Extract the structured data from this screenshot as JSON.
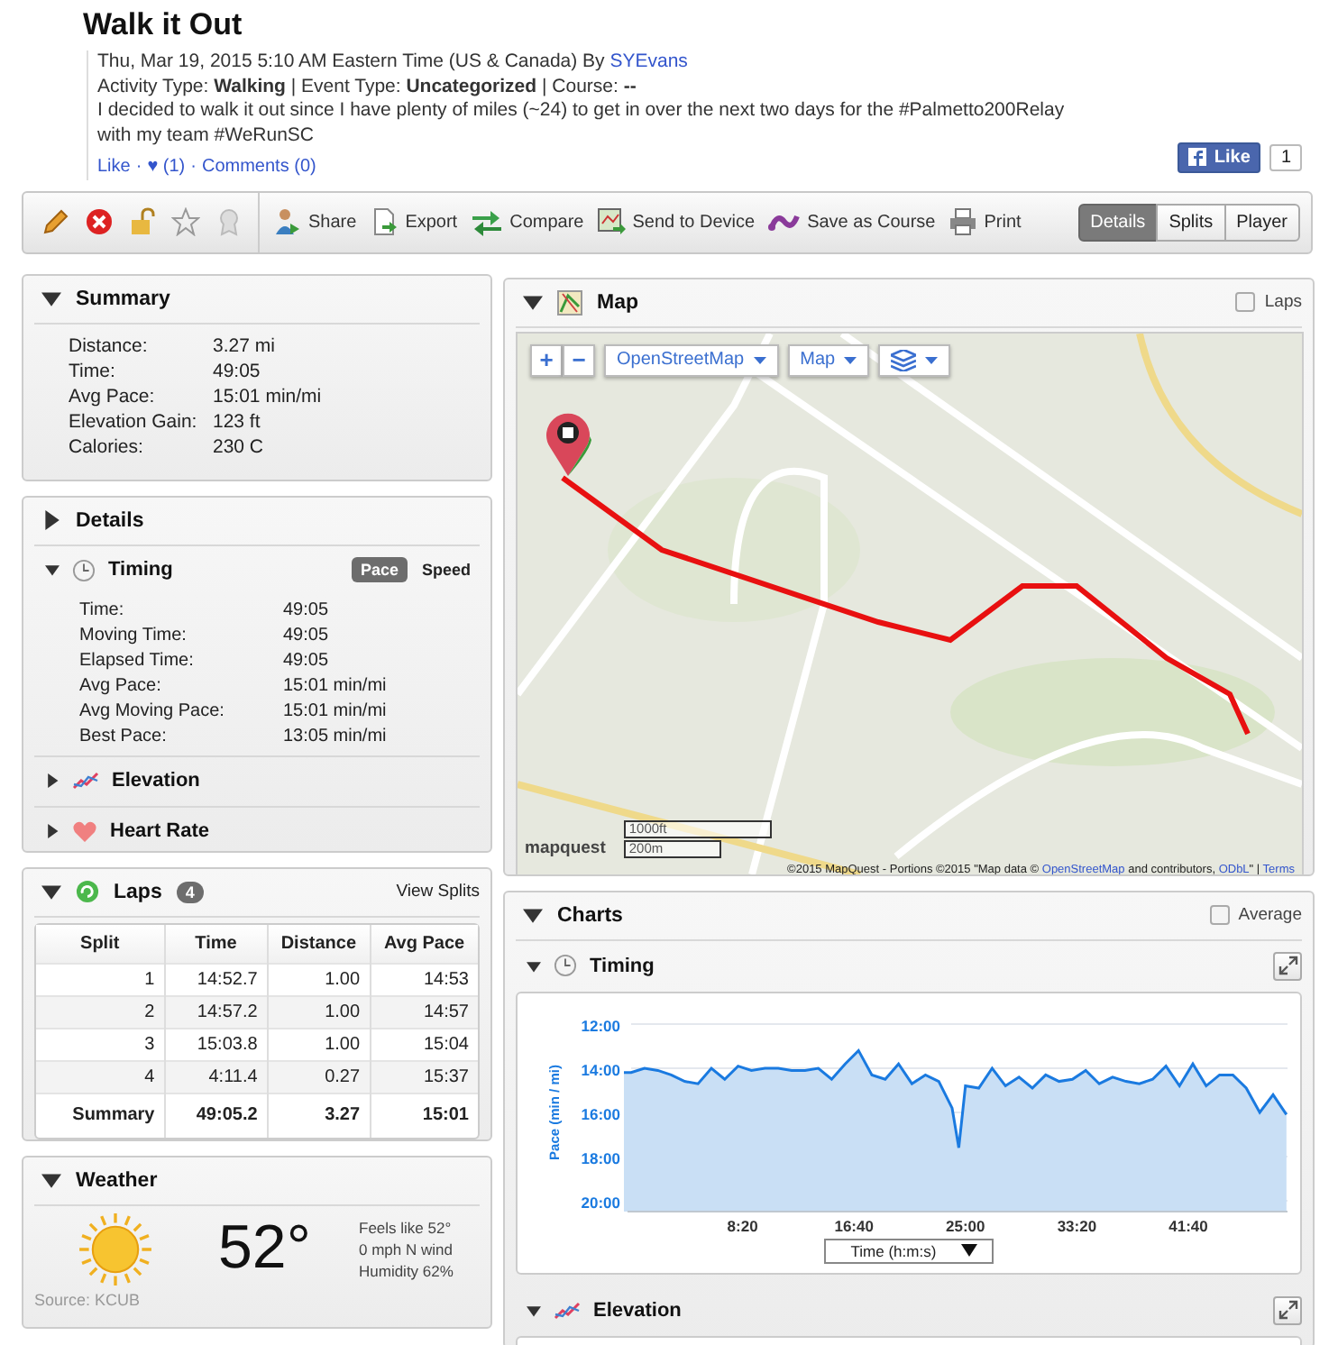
{
  "header": {
    "title": "Walk it Out",
    "date": "Thu, Mar 19, 2015 5:10 AM Eastern Time (US & Canada) By",
    "author": "SYEvans",
    "meta": "Activity Type: **Walking** | Event Type: **Uncategorized** | Course: **--**",
    "description": "I decided to walk it out since I have plenty of miles (~24) to get in over the next two days for the #Palmetto200Relay with my team #WeRunSC",
    "links": [
      "Like",
      "♥ (1)",
      "Comments (0)"
    ],
    "link_separator": "·",
    "fb_like": {
      "label": "Like",
      "count": "1"
    }
  },
  "toolbar": {
    "actions": [
      {
        "label": "Share",
        "kind": "share"
      },
      {
        "label": "Export",
        "kind": "export"
      },
      {
        "label": "Compare",
        "kind": "compare"
      },
      {
        "label": "Send to Device",
        "kind": "device"
      },
      {
        "label": "Save as Course",
        "kind": "course"
      },
      {
        "label": "Print",
        "kind": "print"
      }
    ],
    "views": [
      {
        "label": "Details",
        "selected": true
      },
      {
        "label": "Splits",
        "selected": false
      },
      {
        "label": "Player",
        "selected": false
      }
    ]
  },
  "summary": {
    "title": "Summary",
    "expanded": true,
    "rows": [
      {
        "label": "Distance:",
        "value": "3.27 mi"
      },
      {
        "label": "Time:",
        "value": "49:05"
      },
      {
        "label": "Avg Pace:",
        "value": "15:01 min/mi"
      },
      {
        "label": "Elevation Gain:",
        "value": "123 ft"
      },
      {
        "label": "Calories:",
        "value": "230 C"
      }
    ]
  },
  "details": {
    "title": "Details",
    "expanded": false,
    "sections": [
      {
        "title": "Timing",
        "kind": "timing",
        "expanded": true,
        "toggle": [
          {
            "label": "Pace",
            "selected": true
          },
          {
            "label": "Speed",
            "selected": false
          }
        ],
        "rows": [
          {
            "label": "Time:",
            "value": "49:05"
          },
          {
            "label": "Moving Time:",
            "value": "49:05"
          },
          {
            "label": "Elapsed Time:",
            "value": "49:05"
          },
          {
            "label": "Avg Pace:",
            "value": "15:01 min/mi"
          },
          {
            "label": "Avg Moving Pace:",
            "value": "15:01 min/mi"
          },
          {
            "label": "Best Pace:",
            "value": "13:05 min/mi"
          }
        ]
      },
      {
        "title": "Elevation",
        "kind": "elevation",
        "expanded": false
      },
      {
        "title": "Heart Rate",
        "kind": "heart",
        "expanded": false
      }
    ]
  },
  "laps": {
    "title": "Laps",
    "count": "4",
    "expanded": true,
    "link": "View Splits",
    "columns": [
      "Split",
      "Time",
      "Distance",
      "Avg Pace"
    ],
    "rows": [
      [
        "1",
        "14:52.7",
        "1.00",
        "14:53"
      ],
      [
        "2",
        "14:57.2",
        "1.00",
        "14:57"
      ],
      [
        "3",
        "15:03.8",
        "1.00",
        "15:04"
      ],
      [
        "4",
        "4:11.4",
        "0.27",
        "15:37"
      ]
    ],
    "summary": [
      "Summary",
      "49:05.2",
      "3.27",
      "15:01"
    ]
  },
  "weather": {
    "title": "Weather",
    "expanded": true,
    "temperature": "52°",
    "lines": [
      "Feels like 52°",
      "0 mph N wind",
      "Humidity 62%"
    ],
    "source": "Source: KCUB"
  },
  "map": {
    "title": "Map",
    "expanded": true,
    "laps_checkbox": {
      "label": "Laps",
      "checked": false
    },
    "zoom": [
      "+",
      "−"
    ],
    "dropdowns": [
      "OpenStreetMap",
      "Map"
    ],
    "logo": "mapquest",
    "scale": [
      "1000ft",
      "200m"
    ],
    "attribution": [
      {
        "text": "©2015 MapQuest - Portions ©2015 \"Map data © ",
        "link": false
      },
      {
        "text": "OpenStreetMap",
        "link": true
      },
      {
        "text": " and contributors, ",
        "link": false
      },
      {
        "text": "ODbL",
        "link": true
      },
      {
        "text": "\" | ",
        "link": false
      },
      {
        "text": "Terms",
        "link": true
      }
    ]
  },
  "charts": {
    "title": "Charts",
    "expanded": true,
    "average": {
      "label": "Average",
      "checked": false
    },
    "items": [
      {
        "title": "Timing",
        "kind": "timing",
        "expanded": true,
        "axis_select": "Time (h:m:s)",
        "chart_data": {
          "type": "area",
          "ylabel": "Pace (min / mi)",
          "x": [
            0,
            60,
            120,
            180,
            240,
            300,
            360,
            420,
            480,
            540,
            600,
            660,
            720,
            780,
            840,
            900,
            960,
            1020,
            1080,
            1140,
            1200,
            1260,
            1320,
            1380,
            1440,
            1470,
            1500,
            1560,
            1620,
            1680,
            1740,
            1800,
            1860,
            1920,
            1980,
            2040,
            2100,
            2160,
            2220,
            2280,
            2340,
            2400,
            2460,
            2520,
            2580,
            2640,
            2700,
            2760,
            2820,
            2880,
            2940
          ],
          "values": [
            14.2,
            14.0,
            14.1,
            14.3,
            14.6,
            14.7,
            14.0,
            14.5,
            13.9,
            14.1,
            14.0,
            14.0,
            14.1,
            14.1,
            14.0,
            14.5,
            13.8,
            13.2,
            14.3,
            14.5,
            13.8,
            14.7,
            14.3,
            14.6,
            15.8,
            17.6,
            14.8,
            14.9,
            14.0,
            14.8,
            14.4,
            14.9,
            14.3,
            14.6,
            14.5,
            14.1,
            14.7,
            14.4,
            14.6,
            14.7,
            14.5,
            13.9,
            14.8,
            13.8,
            14.8,
            14.3,
            14.3,
            14.9,
            16.0,
            15.2,
            16.1
          ],
          "ylim": [
            20,
            12
          ],
          "grid": true,
          "yticks": [
            {
              "value": 12,
              "label": "12:00"
            },
            {
              "value": 14,
              "label": "14:00"
            },
            {
              "value": 16,
              "label": "16:00"
            },
            {
              "value": 18,
              "label": "18:00"
            },
            {
              "value": 20,
              "label": "20:00"
            }
          ],
          "xlim": [
            0,
            2945
          ],
          "xticks": [
            {
              "value": 500,
              "label": "8:20"
            },
            {
              "value": 1000,
              "label": "16:40"
            },
            {
              "value": 1500,
              "label": "25:00"
            },
            {
              "value": 2000,
              "label": "33:20"
            },
            {
              "value": 2500,
              "label": "41:40"
            }
          ]
        }
      },
      {
        "title": "Elevation",
        "kind": "elevation",
        "expanded": true
      }
    ]
  }
}
